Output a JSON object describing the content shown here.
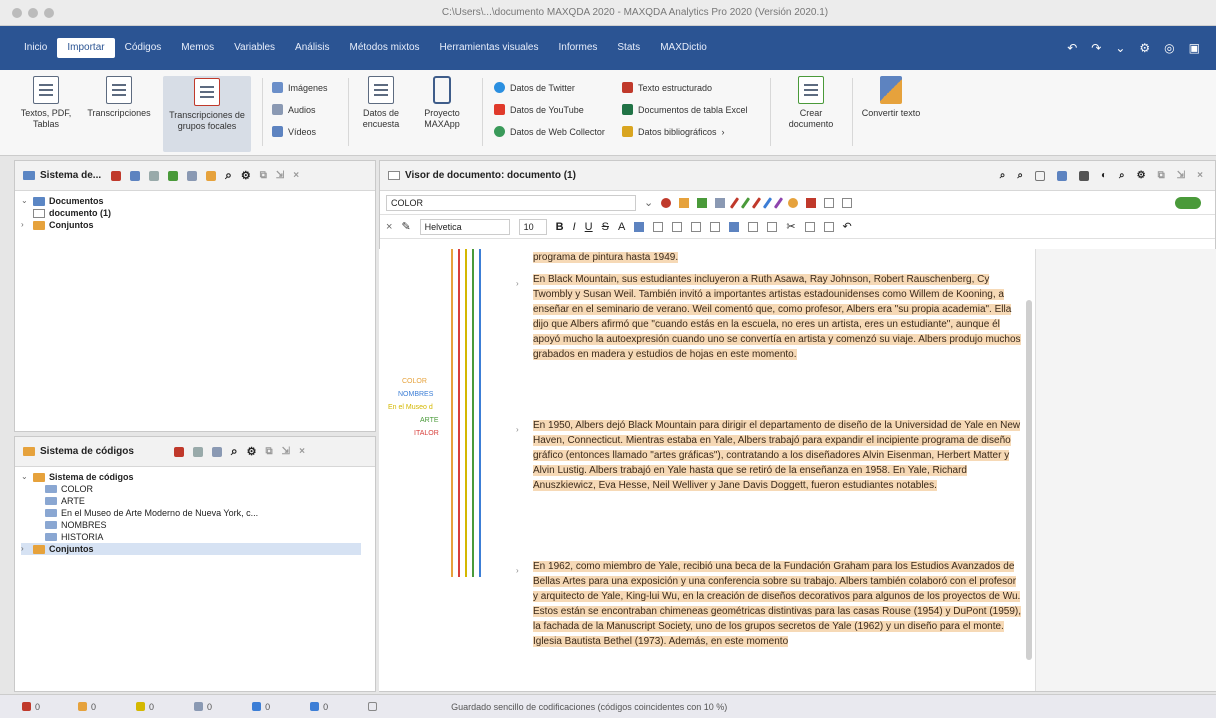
{
  "window": {
    "title": "C:\\Users\\...\\documento MAXQDA 2020 - MAXQDA Analytics Pro 2020 (Versión 2020.1)"
  },
  "menu": {
    "tabs": [
      "Inicio",
      "Importar",
      "Códigos",
      "Memos",
      "Variables",
      "Análisis",
      "Métodos mixtos",
      "Herramientas visuales",
      "Informes",
      "Stats",
      "MAXDictio"
    ],
    "active": "Importar"
  },
  "ribbon": {
    "textos": "Textos, PDF, Tablas",
    "transcripciones": "Transcripciones",
    "transcripciones_grupo": "Transcripciones de grupos focales",
    "imagenes": "Imágenes",
    "audios": "Audios",
    "videos": "Vídeos",
    "datos_encuesta": "Datos de encuesta",
    "proyecto_mobile": "Proyecto MAXApp",
    "twitter": "Datos de Twitter",
    "youtube": "Datos de YouTube",
    "web": "Datos de Web Collector",
    "texto_estructurado": "Texto estructurado",
    "excel": "Documentos de tabla Excel",
    "bibliografia": "Datos bibliográficos",
    "crear_doc": "Crear documento",
    "convertir": "Convertir texto"
  },
  "doc_system": {
    "title": "Sistema de...",
    "items": [
      {
        "label": "Documentos",
        "level": 0
      },
      {
        "label": "documento (1)",
        "level": 1
      },
      {
        "label": "Conjuntos",
        "level": 0
      }
    ]
  },
  "code_system": {
    "title": "Sistema de códigos",
    "items": [
      {
        "label": "Sistema de códigos",
        "level": 0
      },
      {
        "label": "COLOR",
        "level": 1
      },
      {
        "label": "ARTE",
        "level": 1
      },
      {
        "label": "En el Museo de Arte Moderno de Nueva York, c...",
        "level": 1
      },
      {
        "label": "NOMBRES",
        "level": 1
      },
      {
        "label": "HISTORIA",
        "level": 1
      },
      {
        "label": "Conjuntos",
        "level": 0
      }
    ]
  },
  "browser": {
    "title": "Visor de documento: documento (1)",
    "code_field": "COLOR",
    "font": "Helvetica",
    "size": "10"
  },
  "margin_labels": [
    {
      "text": "COLOR",
      "color": "#e6a23c"
    },
    {
      "text": "NOMBRES",
      "color": "#3c7ed6"
    },
    {
      "text": "En el Museo d",
      "color": "#d4b800"
    },
    {
      "text": "ARTE",
      "color": "#4a9a3a"
    },
    {
      "text": "ITALOR",
      "color": "#d8403c"
    }
  ],
  "document": {
    "lead": "programa de pintura hasta 1949.",
    "p1": "En Black Mountain, sus estudiantes incluyeron a Ruth Asawa, Ray Johnson, Robert Rauschenberg, Cy Twombly y Susan Weil. También invitó a importantes artistas estadounidenses como Willem de Kooning, a enseñar en el seminario de verano. Weil comentó que, como profesor, Albers era \"su propia academia\". Ella dijo que Albers afirmó que \"cuando estás en la escuela, no eres un artista, eres un estudiante\", aunque él apoyó mucho la autoexpresión cuando uno se convertía en artista y comenzó su viaje. Albers produjo muchos grabados en madera y estudios de hojas en este momento.",
    "p2": "En 1950, Albers dejó Black Mountain para dirigir el departamento de diseño de la Universidad de Yale en New Haven, Connecticut. Mientras estaba en Yale, Albers trabajó para expandir el incipiente programa de diseño gráfico (entonces llamado \"artes gráficas\"), contratando a los diseñadores Alvin Eisenman, Herbert Matter y Alvin Lustig. Albers trabajó en Yale hasta que se retiró de la enseñanza en 1958. En Yale, Richard Anuszkiewicz, Eva Hesse, Neil Welliver y Jane Davis Doggett, fueron estudiantes notables.",
    "p3": "En 1962, como miembro de Yale, recibió una beca de la Fundación Graham para los Estudios Avanzados de Bellas Artes para una exposición y una conferencia sobre su trabajo. Albers también colaboró con el profesor y arquitecto de Yale, King-lui Wu, en la creación de diseños decorativos para algunos de los proyectos de Wu. Estos están se encontraban chimeneas geométricas distintivas para las casas Rouse (1954) y DuPont (1959), la fachada de la Manuscript Society, uno de los grupos secretos de Yale (1962) y un diseño para el monte. Iglesia Bautista Bethel (1973). Además, en este momento"
  },
  "status": {
    "items": [
      "0",
      "0",
      "0",
      "0",
      "0",
      "0",
      ""
    ],
    "message": "Guardado sencillo de codificaciones (códigos coincidentes con 10 %)"
  }
}
